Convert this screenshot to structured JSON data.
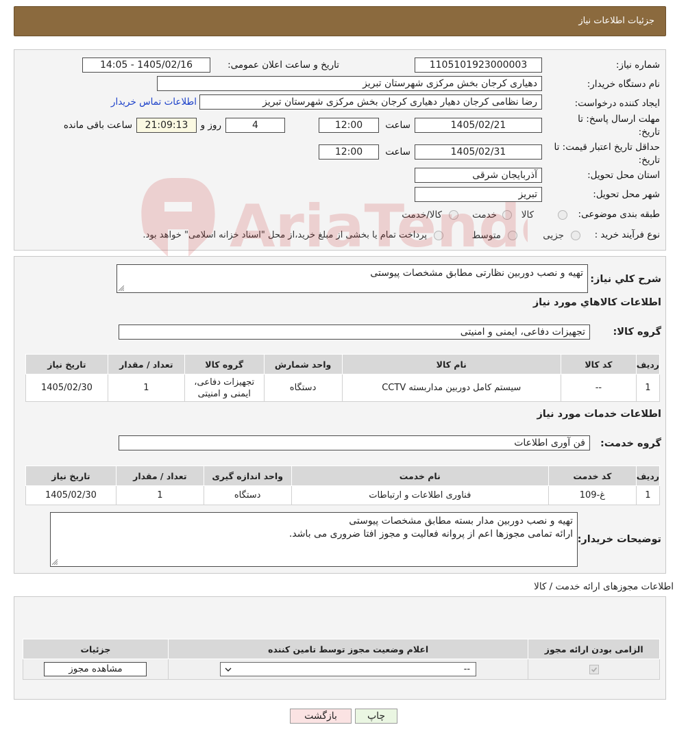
{
  "header": {
    "title": "جزئیات اطلاعات نیاز"
  },
  "info": {
    "need_number_label": "شماره نیاز:",
    "need_number": "1105101923000003",
    "announce_label": "تاریخ و ساعت اعلان عمومی:",
    "announce_value": "1405/02/16 - 14:05",
    "buyer_label": "نام دستگاه خریدار:",
    "buyer_value": "دهیاری کرجان بخش مرکزی شهرستان تبریز",
    "creator_label": "ایجاد کننده درخواست:",
    "creator_value": "رضا نظامی کرجان دهیار دهیاری کرجان بخش مرکزی شهرستان تبریز",
    "contact_link": "اطلاعات تماس خریدار",
    "deadline_label_1": "مهلت ارسال پاسخ: تا",
    "deadline_label_2": "تاریخ:",
    "deadline_date": "1405/02/21",
    "time_label": "ساعت",
    "deadline_time": "12:00",
    "days_value": "4",
    "days_label": "روز و",
    "remaining_time": "21:09:13",
    "remaining_label": "ساعت باقی مانده",
    "validity_label_1": "حداقل تاریخ اعتبار قیمت: تا",
    "validity_label_2": "تاریخ:",
    "validity_date": "1405/02/31",
    "validity_time": "12:00",
    "province_label": "استان محل تحویل:",
    "province_value": "آذربایجان شرقی",
    "city_label": "شهر محل تحویل:",
    "city_value": "تبریز",
    "category_label": "طبقه بندی موضوعی:",
    "category_options": [
      "کالا",
      "خدمت",
      "کالا/خدمت"
    ],
    "process_label": "نوع فرآیند خرید :",
    "process_options": [
      "جزیی",
      "متوسط"
    ],
    "process_note": "پرداخت تمام یا بخشی از مبلغ خرید،از محل \"اسناد خزانه اسلامی\" خواهد بود."
  },
  "details": {
    "summary_label": "شرح کلي نياز:",
    "summary_value": "تهیه و نصب دوربین نظارتی مطابق مشخصات پیوستی",
    "goods_title": "اطلاعات کالاهاي مورد نياز",
    "goods_group_label": "گروه کالا:",
    "goods_group_value": "تجهیزات دفاعی، ایمنی و امنیتی",
    "goods_headers": [
      "رديف",
      "کد کالا",
      "نام کالا",
      "واحد شمارش",
      "گروه کالا",
      "تعداد / مقدار",
      "تاريخ نياز"
    ],
    "goods_rows": [
      [
        "1",
        "--",
        "سیستم کامل دوربین مداربسته CCTV",
        "دستگاه",
        "تجهیزات دفاعی، ایمنی و امنیتی",
        "1",
        "1405/02/30"
      ]
    ],
    "services_title": "اطلاعات خدمات مورد نياز",
    "service_group_label": "گروه خدمت:",
    "service_group_value": "فن آوری اطلاعات",
    "service_headers": [
      "رديف",
      "کد خدمت",
      "نام خدمت",
      "واحد اندازه گيری",
      "تعداد / مقدار",
      "تاريخ نياز"
    ],
    "service_rows": [
      [
        "1",
        "غ-109",
        "فناوری اطلاعات و ارتباطات",
        "دستگاه",
        "1",
        "1405/02/30"
      ]
    ],
    "buyer_notes_label": "توضیحات خریدار:",
    "buyer_notes_line1": "تهیه و نصب دوربین مدار بسته مطابق مشخصات پیوستی",
    "buyer_notes_line2": "ارائه تمامی مجوزها اعم از پروانه فعالیت و مجوز افتا ضروری می باشد."
  },
  "permits": {
    "title": "اطلاعات مجوزهای ارائه خدمت / کالا",
    "headers": [
      "الزامی بودن ارائه مجوز",
      "اعلام وضعیت مجوز توسط تامین کننده",
      "جزئیات"
    ],
    "select_value": "--",
    "view_button": "مشاهده مجوز"
  },
  "footer": {
    "print_button": "چاپ",
    "back_button": "بازگشت"
  },
  "colors": {
    "header_bg": "#8b6a3e",
    "link": "#1a3fc9",
    "back_button_bg": "#fbe3e3",
    "print_button_bg": "#eaf6e2"
  }
}
